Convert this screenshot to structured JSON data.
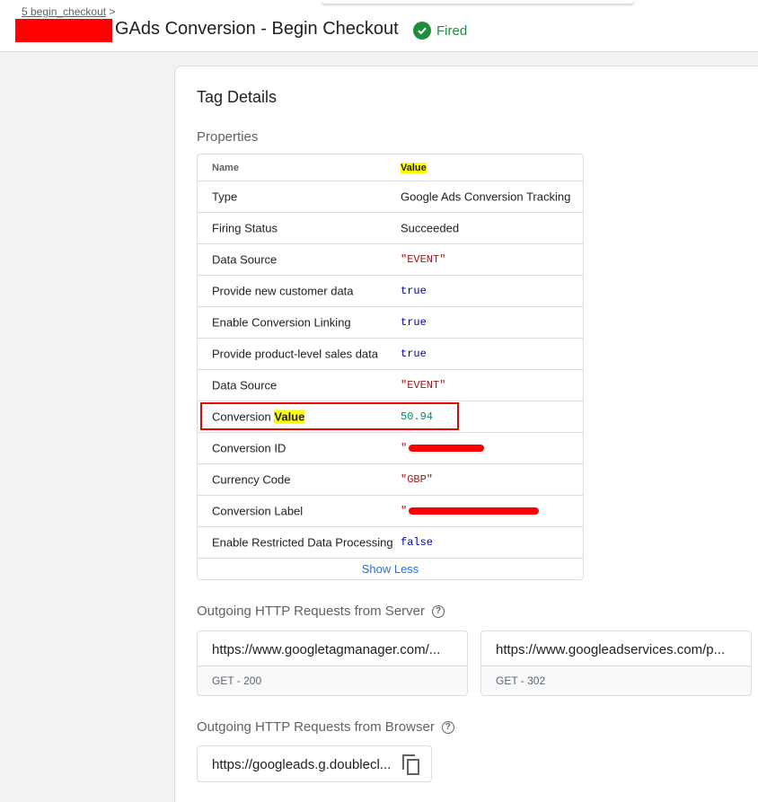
{
  "header": {
    "breadcrumb": "5 begin_checkout",
    "breadcrumb_sep": ">",
    "title": "GAds Conversion - Begin Checkout",
    "status": "Fired",
    "status_color": "#1e8e3e"
  },
  "card": {
    "title": "Tag Details",
    "properties_label": "Properties",
    "columns": {
      "name": "Name",
      "value": "Value"
    },
    "rows": [
      {
        "name": "Type",
        "value": "Google Ads Conversion Tracking",
        "kind": "text"
      },
      {
        "name": "Firing Status",
        "value": "Succeeded",
        "kind": "text"
      },
      {
        "name": "Data Source",
        "value": "\"EVENT\"",
        "kind": "string"
      },
      {
        "name": "Provide new customer data",
        "value": "true",
        "kind": "bool"
      },
      {
        "name": "Enable Conversion Linking",
        "value": "true",
        "kind": "bool"
      },
      {
        "name": "Provide product-level sales data",
        "value": "true",
        "kind": "bool"
      },
      {
        "name": "Data Source",
        "value": "\"EVENT\"",
        "kind": "string"
      },
      {
        "name": "Conversion",
        "name_highlight": "Value",
        "value": "50.94",
        "kind": "number"
      },
      {
        "name": "Conversion ID",
        "value": "\"",
        "kind": "string"
      },
      {
        "name": "Currency Code",
        "value": "\"GBP\"",
        "kind": "string"
      },
      {
        "name": "Conversion Label",
        "value": "\"",
        "kind": "string"
      },
      {
        "name": "Enable Restricted Data Processing",
        "value": "false",
        "kind": "bool"
      }
    ],
    "show_less": "Show Less",
    "server_label": "Outgoing HTTP Requests from Server",
    "server_requests": [
      {
        "url": "https://www.googletagmanager.com/...",
        "status": "GET - 200"
      },
      {
        "url": "https://www.googleadservices.com/p...",
        "status": "GET - 302"
      }
    ],
    "browser_label": "Outgoing HTTP Requests from Browser",
    "browser_requests": [
      {
        "url": "https://googleads.g.doublecl..."
      }
    ],
    "help_glyph": "?"
  }
}
